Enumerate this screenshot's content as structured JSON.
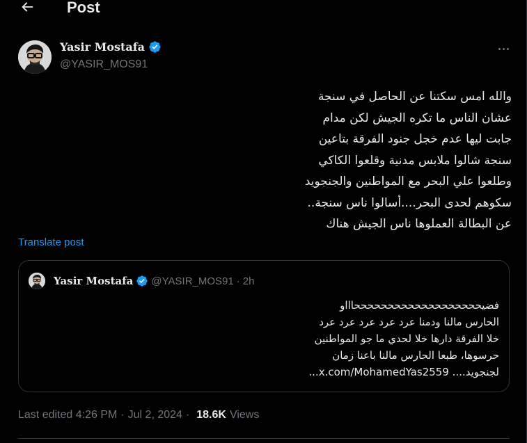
{
  "header": {
    "title": "Post",
    "back_icon": "arrow-left-icon"
  },
  "author": {
    "name": "Yasir Mostafa",
    "handle": "@YASIR_MOS91",
    "verified_icon": "verified-badge-icon",
    "more_icon": "more-horizontal-icon"
  },
  "tweet": {
    "lines": [
      "والله امس سكتنا عن الحاصل في سنجة",
      "عشان الناس ما تكره الجيش لكن مدام",
      "جابت ليها عدم خجل جنود الفرقة بتاعين",
      "سنجة شالوا ملابس مدنية وقلعوا الكاكي",
      "وطلعوا علي البحر مع المواطنين والجنجويد",
      "سكوهم لحدى البحر....أسالوا ناس سنجة..",
      "عن البطالة العملوها ناس الجيش هناك"
    ],
    "translate_label": "Translate post"
  },
  "quote": {
    "name": "Yasir Mostafa",
    "handle": "@YASIR_MOS91",
    "dot": "·",
    "time": "2h",
    "lines": [
      "فضيحححححححححححححححححححاااو",
      "الحارس مالنا ودمنا عرد عرد عرد عرد عرد",
      "خلا الفرقة دارها خلا لحدي ما جو المواطنين",
      "حرسوها، طبعا الحارس مالنا باعنا زمان",
      "لجنجويد.... x.com/MohamedYas2559..."
    ]
  },
  "meta": {
    "edited": "Last edited 4:26 PM",
    "sep": "·",
    "date": "Jul 2, 2024",
    "views_count": "18.6K",
    "views_label": "Views"
  },
  "colors": {
    "background": "#000000",
    "text": "#e7e9ea",
    "muted": "#71767b",
    "accent": "#1d9bf0",
    "border": "#2f3336"
  }
}
